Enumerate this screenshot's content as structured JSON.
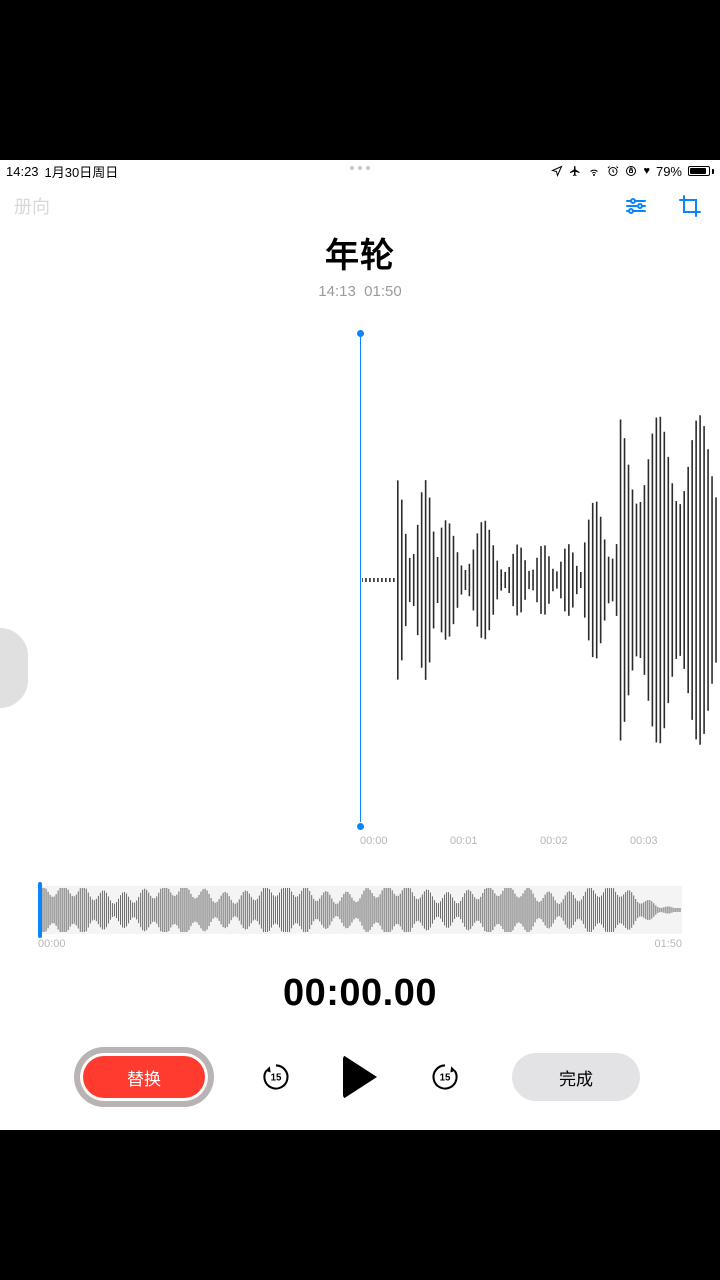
{
  "statusbar": {
    "time": "14:23",
    "date": "1月30日周日",
    "battery_pct": "79%"
  },
  "toolbar": {
    "back_label": "册向"
  },
  "recording": {
    "title": "年轮",
    "time_label": "14:13",
    "duration": "01:50"
  },
  "waveform": {
    "ticks": [
      "00:00",
      "00:01",
      "00:02",
      "00:03"
    ]
  },
  "minimap": {
    "start": "00:00",
    "end": "01:50"
  },
  "timer": "00:00.00",
  "controls": {
    "replace_label": "替换",
    "done_label": "完成",
    "skip_seconds": "15"
  }
}
